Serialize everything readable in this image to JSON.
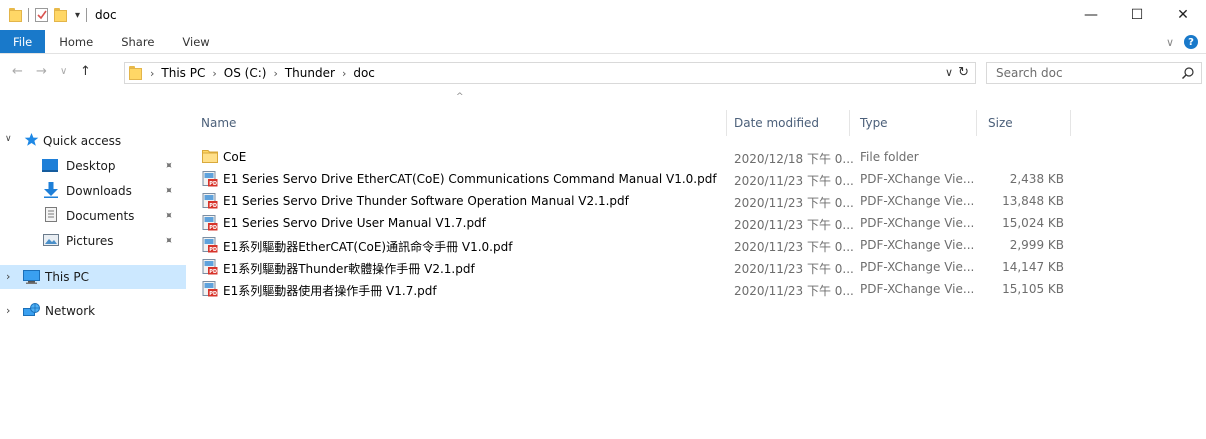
{
  "window": {
    "title": "doc",
    "minimize_symbol": "—",
    "maximize_symbol": "☐",
    "close_symbol": "✕"
  },
  "ribbon": {
    "tabs": [
      "File",
      "Home",
      "Share",
      "View"
    ],
    "expand_symbol": "∨",
    "help_symbol": "?"
  },
  "address": {
    "crumbs": [
      "This PC",
      "OS (C:)",
      "Thunder",
      "doc"
    ],
    "separator": "›",
    "dropdown_symbol": "∨",
    "refresh_symbol": "↻"
  },
  "nav_buttons": {
    "back": "←",
    "forward": "→",
    "recent": "∨",
    "up": "↑"
  },
  "search": {
    "placeholder": "Search doc"
  },
  "navpane": {
    "quick_access": "Quick access",
    "items": [
      "Desktop",
      "Downloads",
      "Documents",
      "Pictures"
    ],
    "this_pc": "This PC",
    "network": "Network",
    "pin_symbol": "📌",
    "expanded_symbol": "∨",
    "collapsed_symbol": "›"
  },
  "columns": {
    "name": "Name",
    "date": "Date modified",
    "type": "Type",
    "size": "Size",
    "sort_symbol": "^"
  },
  "files": [
    {
      "name": "CoE",
      "date": "2020/12/18 下午 0...",
      "type": "File folder",
      "size": "",
      "kind": "folder"
    },
    {
      "name": "E1 Series Servo Drive EtherCAT(CoE) Communications Command Manual V1.0.pdf",
      "date": "2020/11/23 下午 0...",
      "type": "PDF-XChange Vie...",
      "size": "2,438 KB",
      "kind": "pdf"
    },
    {
      "name": "E1 Series Servo Drive Thunder Software Operation Manual V2.1.pdf",
      "date": "2020/11/23 下午 0...",
      "type": "PDF-XChange Vie...",
      "size": "13,848 KB",
      "kind": "pdf"
    },
    {
      "name": "E1 Series Servo Drive User Manual V1.7.pdf",
      "date": "2020/11/23 下午 0...",
      "type": "PDF-XChange Vie...",
      "size": "15,024 KB",
      "kind": "pdf"
    },
    {
      "name": "E1系列驅動器EtherCAT(CoE)通訊命令手冊 V1.0.pdf",
      "date": "2020/11/23 下午 0...",
      "type": "PDF-XChange Vie...",
      "size": "2,999 KB",
      "kind": "pdf"
    },
    {
      "name": "E1系列驅動器Thunder軟體操作手冊 V2.1.pdf",
      "date": "2020/11/23 下午 0...",
      "type": "PDF-XChange Vie...",
      "size": "14,147 KB",
      "kind": "pdf"
    },
    {
      "name": "E1系列驅動器使用者操作手冊 V1.7.pdf",
      "date": "2020/11/23 下午 0...",
      "type": "PDF-XChange Vie...",
      "size": "15,105 KB",
      "kind": "pdf"
    }
  ],
  "colors": {
    "accent": "#1979ca",
    "selection": "#cce8ff",
    "folder": "#ffd766"
  }
}
